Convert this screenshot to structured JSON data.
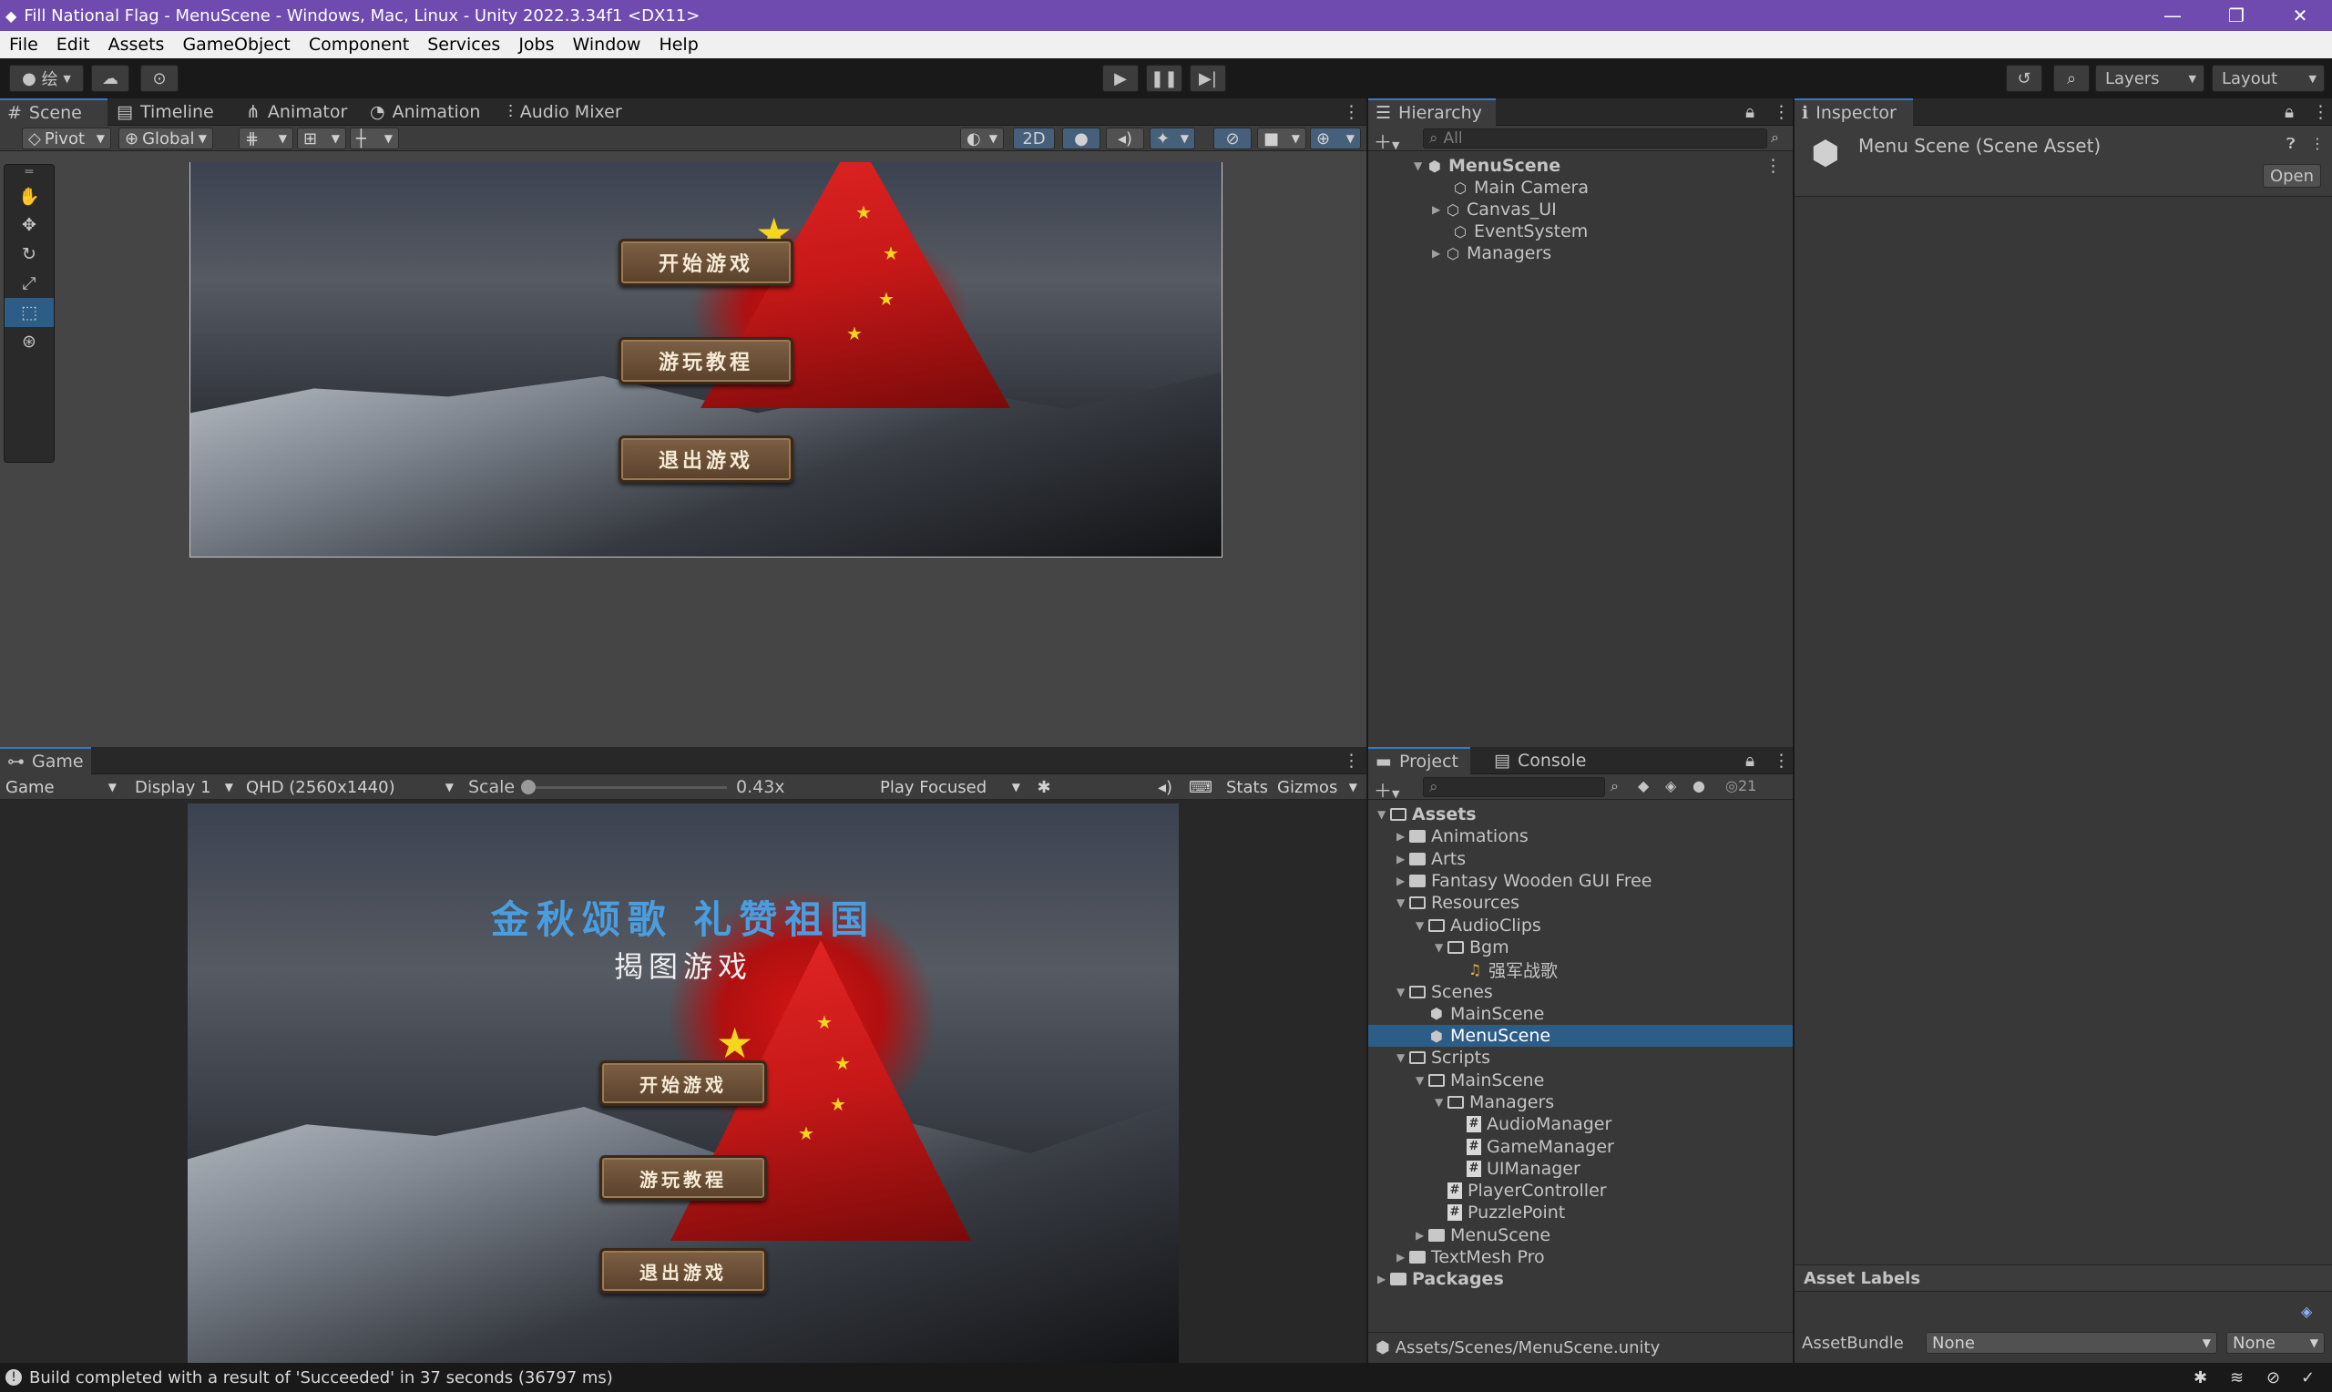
{
  "window": {
    "title": "Fill National Flag - MenuScene - Windows, Mac, Linux - Unity 2022.3.34f1 <DX11>",
    "minimize": "—",
    "restore": "❐",
    "close": "✕"
  },
  "menu": [
    "File",
    "Edit",
    "Assets",
    "GameObject",
    "Component",
    "Services",
    "Jobs",
    "Window",
    "Help"
  ],
  "toolbar": {
    "account_label": "绘",
    "layers_label": "Layers",
    "layout_label": "Layout"
  },
  "scene_panel": {
    "tabs": [
      "Scene",
      "Timeline",
      "Animator",
      "Animation",
      "Audio Mixer"
    ],
    "pivot_label": "Pivot",
    "global_label": "Global",
    "mode_2d": "2D",
    "buttons": [
      "开始游戏",
      "游玩教程",
      "退出游戏"
    ]
  },
  "game_panel": {
    "tab": "Game",
    "view_dropdown": "Game",
    "display_dropdown": "Display 1",
    "resolution_dropdown": "QHD (2560x1440)",
    "scale_label": "Scale",
    "scale_value": "0.43x",
    "play_mode_dropdown": "Play Focused",
    "stats_label": "Stats",
    "gizmos_label": "Gizmos",
    "heading": "金秋颂歌 礼赞祖国",
    "subheading": "揭图游戏",
    "buttons": [
      "开始游戏",
      "游玩教程",
      "退出游戏"
    ]
  },
  "hierarchy": {
    "tab": "Hierarchy",
    "search_placeholder": "All",
    "root": "MenuScene",
    "items": [
      "Main Camera",
      "Canvas_UI",
      "EventSystem",
      "Managers"
    ]
  },
  "inspector": {
    "tab": "Inspector",
    "title": "Menu Scene (Scene Asset)",
    "open_button": "Open",
    "asset_labels": "Asset Labels",
    "assetbundle_label": "AssetBundle",
    "assetbundle_value": "None",
    "variant_value": "None"
  },
  "project": {
    "tabs": [
      "Project",
      "Console"
    ],
    "hidden_count": "21",
    "path": "Assets/Scenes/MenuScene.unity",
    "tree": [
      {
        "label": "Assets",
        "depth": 0,
        "type": "folder-open",
        "expand": "open",
        "bold": true
      },
      {
        "label": "Animations",
        "depth": 1,
        "type": "folder",
        "expand": "closed"
      },
      {
        "label": "Arts",
        "depth": 1,
        "type": "folder",
        "expand": "closed"
      },
      {
        "label": "Fantasy Wooden GUI  Free",
        "depth": 1,
        "type": "folder",
        "expand": "closed"
      },
      {
        "label": "Resources",
        "depth": 1,
        "type": "folder-open",
        "expand": "open"
      },
      {
        "label": "AudioClips",
        "depth": 2,
        "type": "folder-open",
        "expand": "open"
      },
      {
        "label": "Bgm",
        "depth": 3,
        "type": "folder-open",
        "expand": "open"
      },
      {
        "label": "强军战歌",
        "depth": 4,
        "type": "audio",
        "expand": "none"
      },
      {
        "label": "Scenes",
        "depth": 1,
        "type": "folder-open",
        "expand": "open"
      },
      {
        "label": "MainScene",
        "depth": 2,
        "type": "scene",
        "expand": "none"
      },
      {
        "label": "MenuScene",
        "depth": 2,
        "type": "scene",
        "expand": "none",
        "selected": true
      },
      {
        "label": "Scripts",
        "depth": 1,
        "type": "folder-open",
        "expand": "open"
      },
      {
        "label": "MainScene",
        "depth": 2,
        "type": "folder-open",
        "expand": "open"
      },
      {
        "label": "Managers",
        "depth": 3,
        "type": "folder-open",
        "expand": "open"
      },
      {
        "label": "AudioManager",
        "depth": 4,
        "type": "script",
        "expand": "none"
      },
      {
        "label": "GameManager",
        "depth": 4,
        "type": "script",
        "expand": "none"
      },
      {
        "label": "UIManager",
        "depth": 4,
        "type": "script",
        "expand": "none"
      },
      {
        "label": "PlayerController",
        "depth": 3,
        "type": "script",
        "expand": "none"
      },
      {
        "label": "PuzzlePoint",
        "depth": 3,
        "type": "script",
        "expand": "none"
      },
      {
        "label": "MenuScene",
        "depth": 2,
        "type": "folder",
        "expand": "closed"
      },
      {
        "label": "TextMesh Pro",
        "depth": 1,
        "type": "folder",
        "expand": "closed"
      },
      {
        "label": "Packages",
        "depth": 0,
        "type": "folder",
        "expand": "closed",
        "bold": true
      }
    ]
  },
  "status": {
    "message": "Build completed with a result of 'Succeeded' in 37 seconds (36797 ms)"
  },
  "colors": {
    "titlebar": "#6f4bb0",
    "selection": "#2c5d87",
    "accent": "#3a79bb",
    "heading_blue": "#4a9ee0"
  }
}
